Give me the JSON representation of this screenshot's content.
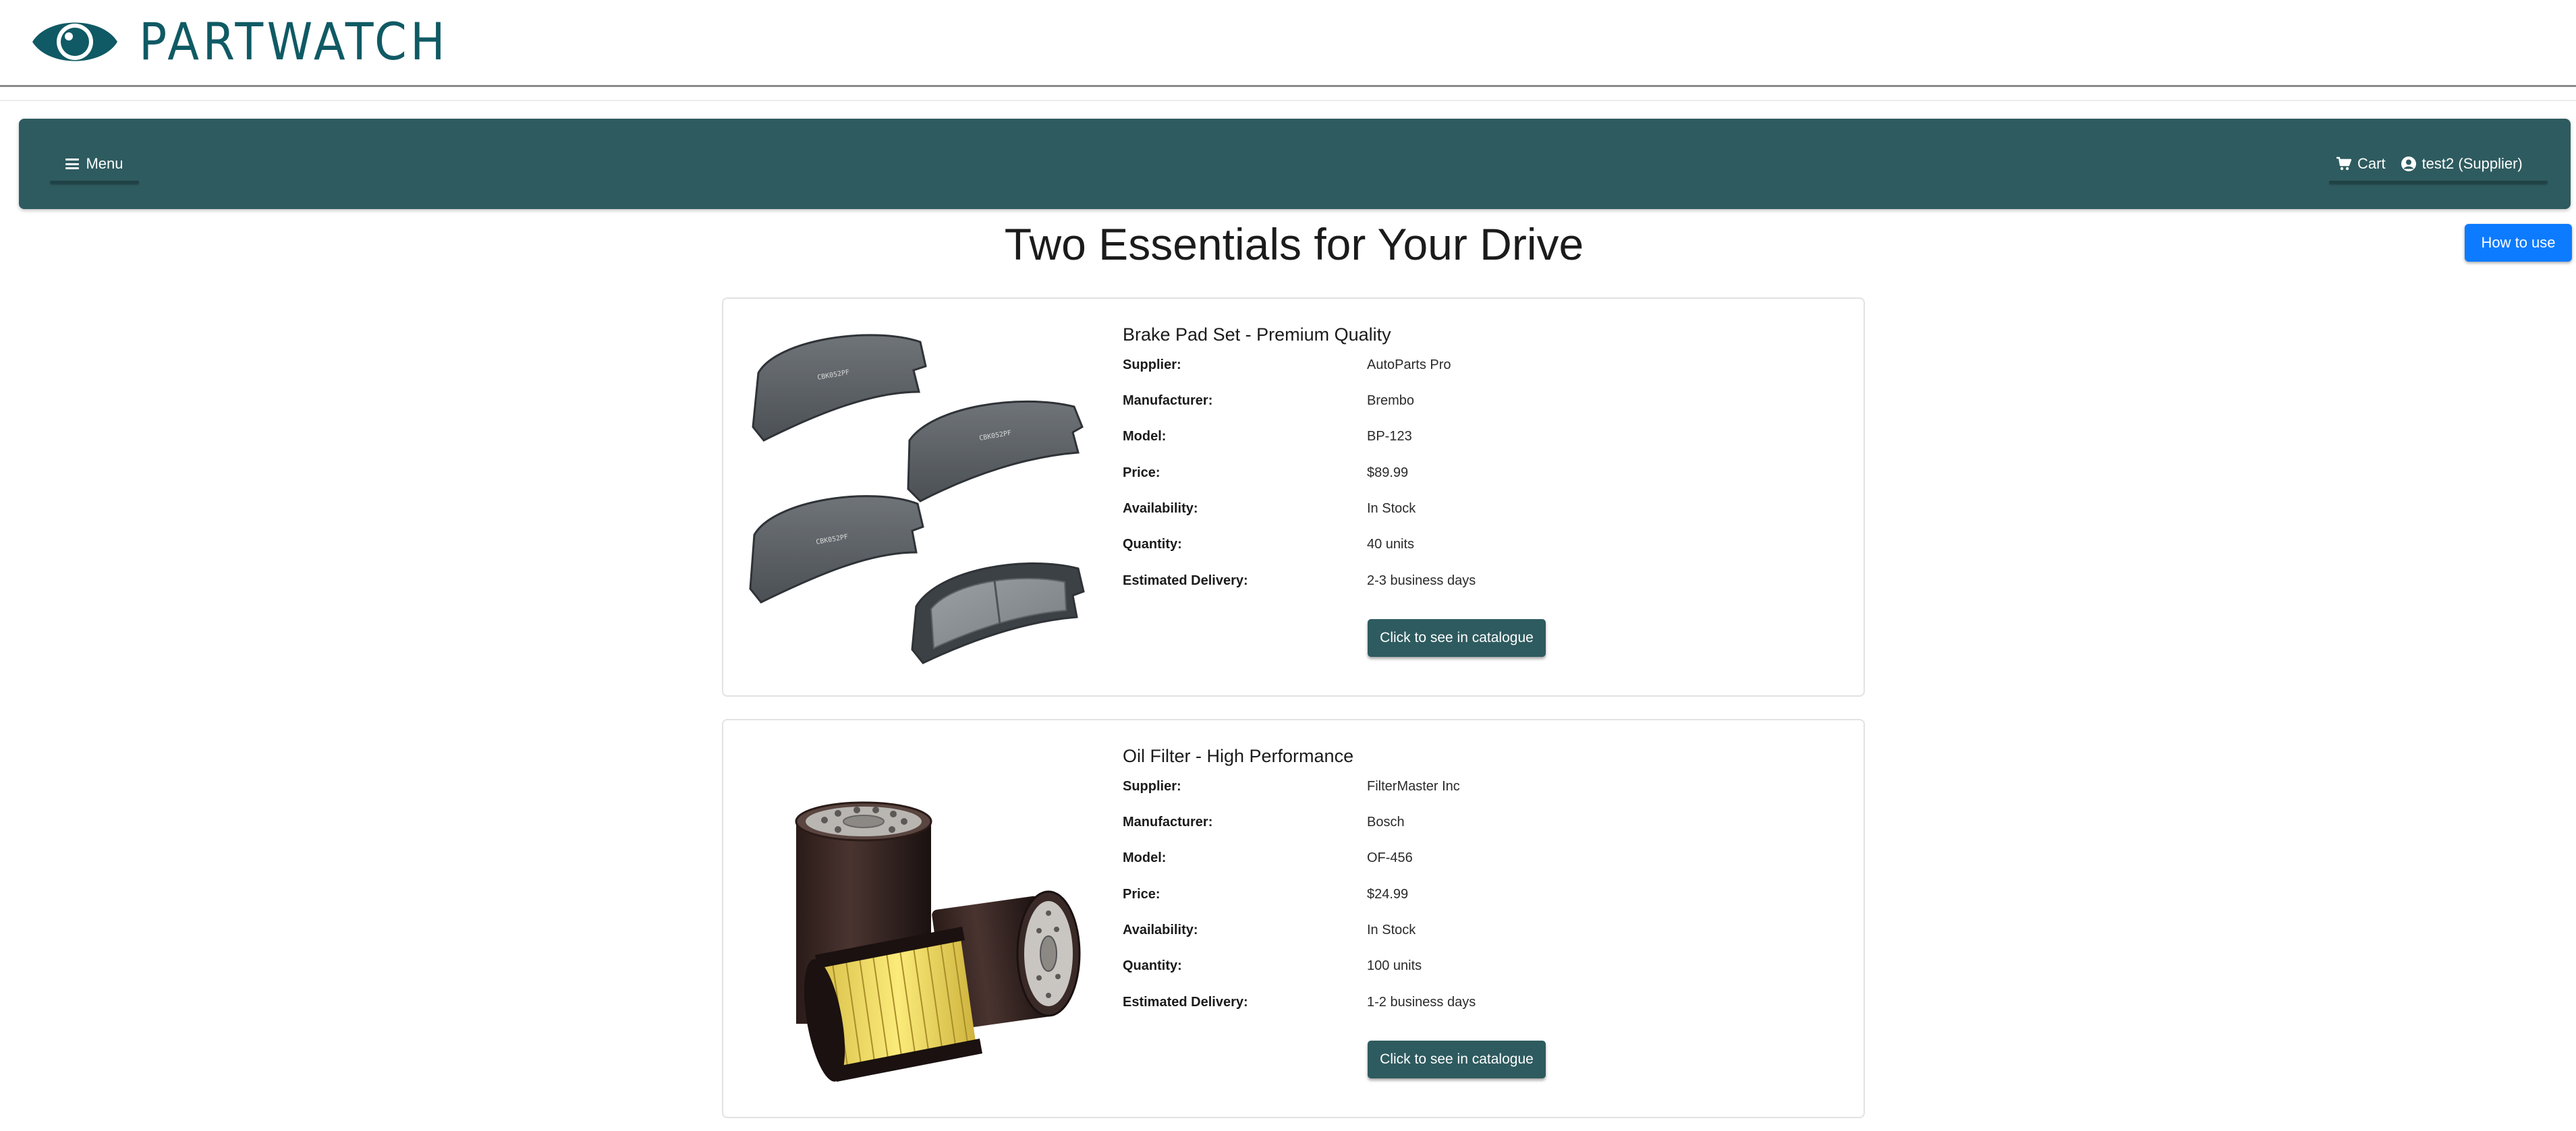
{
  "brand": {
    "name": "PARTWATCH",
    "color": "#0f5a64"
  },
  "nav": {
    "menu_label": "Menu",
    "cart_label": "Cart",
    "user_label": "test2 (Supplier)"
  },
  "howto_label": "How to use",
  "page_title": "Two Essentials for Your Drive",
  "labels": {
    "supplier": "Supplier:",
    "manufacturer": "Manufacturer:",
    "model": "Model:",
    "price": "Price:",
    "availability": "Availability:",
    "quantity": "Quantity:",
    "delivery": "Estimated Delivery:"
  },
  "products": [
    {
      "name": "Brake Pad Set - Premium Quality",
      "supplier": "AutoParts Pro",
      "manufacturer": "Brembo",
      "model": "BP-123",
      "price": "$89.99",
      "availability": "In Stock",
      "quantity": "40 units",
      "delivery": "2-3 business days",
      "button_label": "Click to see in catalogue",
      "image": "brake-pad-image"
    },
    {
      "name": "Oil Filter - High Performance",
      "supplier": "FilterMaster Inc",
      "manufacturer": "Bosch",
      "model": "OF-456",
      "price": "$24.99",
      "availability": "In Stock",
      "quantity": "100 units",
      "delivery": "1-2 business days",
      "button_label": "Click to see in catalogue",
      "image": "oil-filter-image"
    }
  ],
  "colors": {
    "nav_bg": "#2e5b5f",
    "accent_button": "#0d7bff",
    "catalogue_button": "#2e5b5f"
  }
}
